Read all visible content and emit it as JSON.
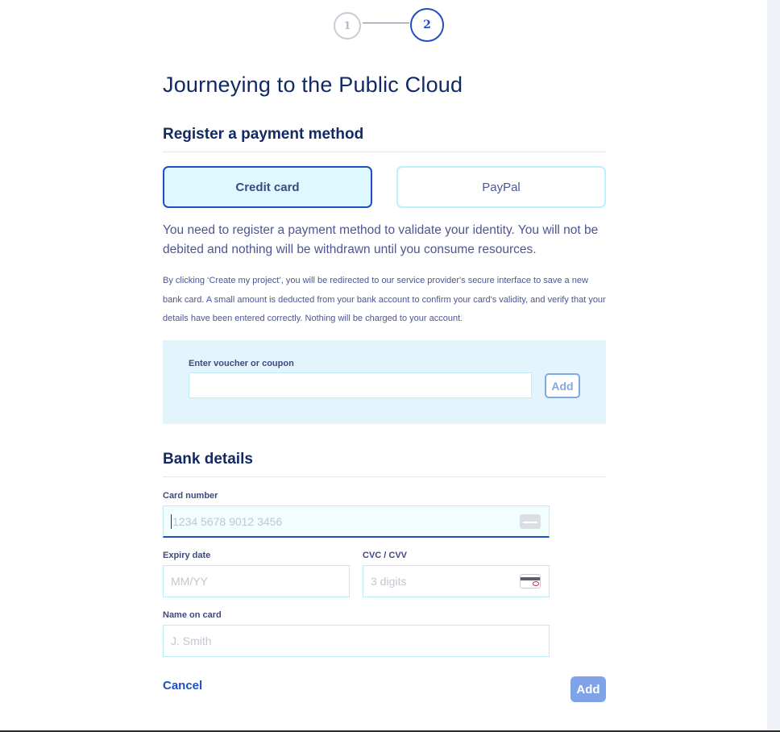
{
  "stepper": {
    "steps": [
      {
        "label": "1",
        "state": "done"
      },
      {
        "label": "2",
        "state": "current"
      }
    ]
  },
  "page": {
    "title": "Journeying to the Public Cloud"
  },
  "payment": {
    "section_title": "Register a payment method",
    "methods": [
      {
        "label": "Credit card",
        "selected": true
      },
      {
        "label": "PayPal",
        "selected": false
      }
    ],
    "intro": "You need to register a payment method to validate your identity. You will not be debited and nothing will be withdrawn until you consume resources.",
    "notice": "By clicking ‘Create my project’, you will be redirected to our service provider's secure interface to save a new bank card. A small amount is deducted from your bank account to confirm your card's validity, and verify that your details have been entered correctly. Nothing will be charged to your account."
  },
  "voucher": {
    "label": "Enter voucher or coupon",
    "value": "",
    "add_label": "Add"
  },
  "bank": {
    "section_title": "Bank details",
    "card_number": {
      "label": "Card number",
      "placeholder": "1234 5678 9012 3456",
      "icon": "credit-card-icon"
    },
    "expiry": {
      "label": "Expiry date",
      "placeholder": "MM/YY"
    },
    "cvc": {
      "label": "CVC / CVV",
      "placeholder": "3 digits",
      "icon": "card-cvc-icon"
    },
    "name": {
      "label": "Name on card",
      "placeholder": "J. Smith"
    }
  },
  "actions": {
    "cancel_label": "Cancel",
    "add_label": "Add"
  },
  "colors": {
    "primary": "#1f4fbf",
    "heading": "#122a63",
    "body_text": "#4d5693",
    "selected_bg": "#dff7ff",
    "voucher_bg": "#e4f4fd",
    "disabled_button": "#7fa3e8"
  }
}
